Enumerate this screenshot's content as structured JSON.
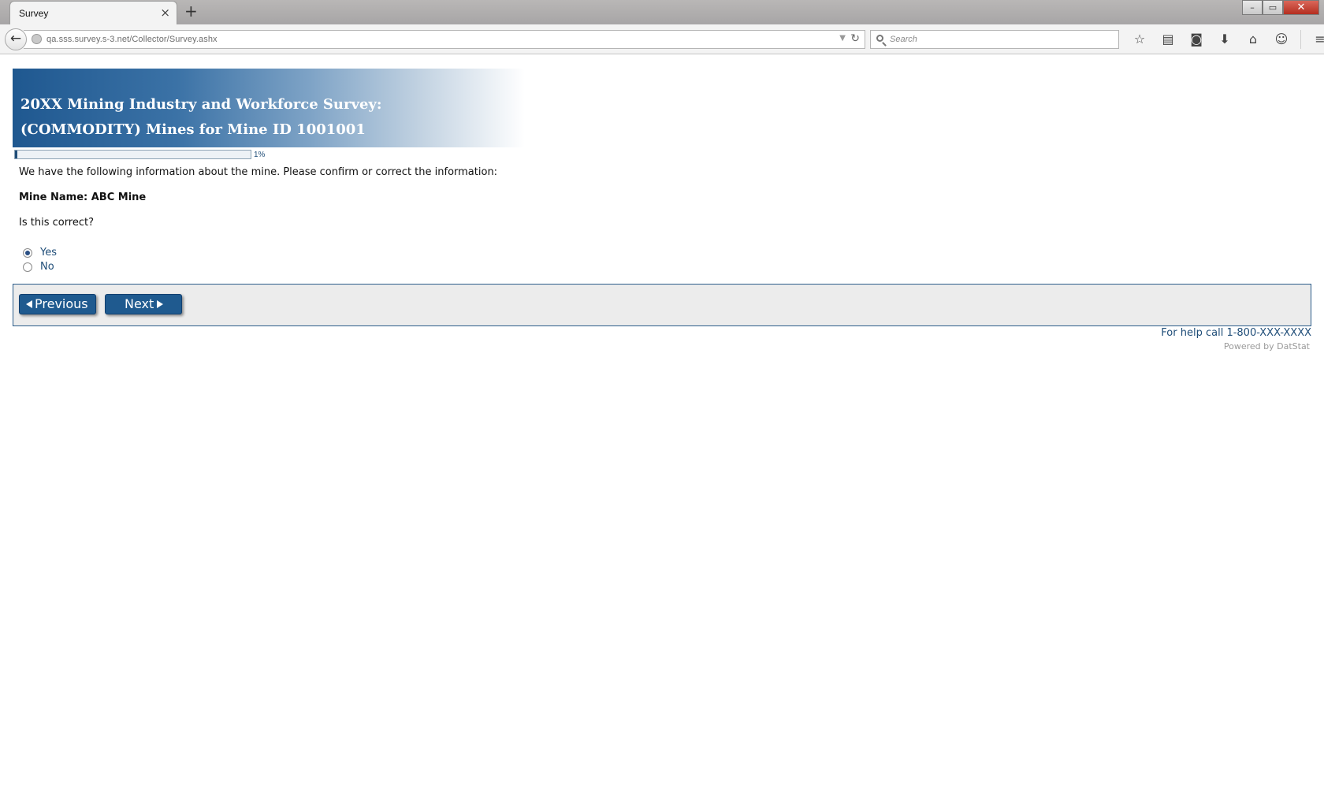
{
  "browser": {
    "tab_title": "Survey",
    "tab_close": "×",
    "new_tab": "+",
    "url": "qa.sss.survey.s-3.net/Collector/Survey.ashx",
    "search_placeholder": "Search",
    "window_controls": {
      "minimize": "–",
      "maximize": "▭",
      "close": "✕"
    },
    "toolbar_icons": [
      "star-icon",
      "reading-list-icon",
      "pocket-icon",
      "download-icon",
      "home-icon",
      "chat-icon",
      "menu-icon"
    ]
  },
  "survey": {
    "title_line1": "20XX Mining Industry and Workforce Survey:",
    "title_line2": "(COMMODITY) Mines for Mine ID 1001001",
    "progress_percent": 1,
    "progress_label": "1%",
    "intro": "We have the following information about the mine.  Please confirm or correct the information:",
    "mine_name": "Mine Name: ABC Mine",
    "question": "Is this correct?",
    "options": [
      {
        "label": "Yes",
        "selected": true
      },
      {
        "label": "No",
        "selected": false
      }
    ],
    "previous_label": "Previous",
    "next_label": "Next",
    "help_text": "For help call 1-800-XXX-XXXX",
    "powered_by": "Powered by DatStat"
  },
  "colors": {
    "brand_blue": "#1f5a8f",
    "text_blue": "#1f4d78"
  }
}
